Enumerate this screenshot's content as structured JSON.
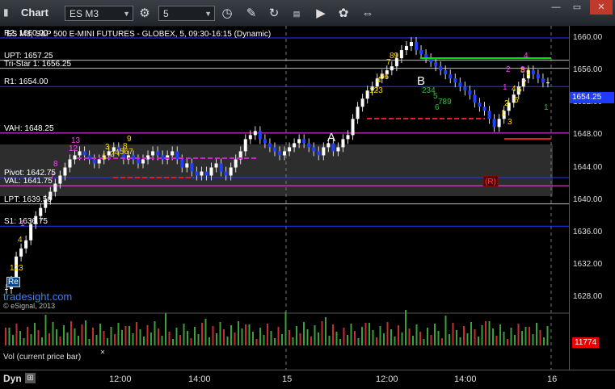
{
  "window": {
    "title": "Chart",
    "symbol": "ES M3",
    "interval": "5",
    "controls": {
      "minimize": "—",
      "restore": "▭",
      "close": "✕"
    }
  },
  "chart": {
    "header": "ES M3, S&P 500 E-MINI FUTURES - GLOBEX, 5, 09:30-16:15 (Dynamic)",
    "watermark_brand": "tradesight.com",
    "copyright": "© eSignal, 2013",
    "current_price": "1654.25",
    "pattern_labels": [
      "A",
      "B"
    ],
    "signal_box": "(R)"
  },
  "levels": [
    {
      "name": "R2",
      "text": "R2: 1660.00",
      "price": 1660.0,
      "color": "#1e3cff"
    },
    {
      "name": "UPT",
      "text": "UPT: 1657.25",
      "price": 1657.25,
      "color": "#bbbbbb"
    },
    {
      "name": "TriStar",
      "text": "Tri-Star 1: 1656.25",
      "price": 1656.25,
      "color": "#bbbbbb"
    },
    {
      "name": "R1",
      "text": "R1: 1654.00",
      "price": 1654.0,
      "color": "#1e3cff"
    },
    {
      "name": "VAH",
      "text": "VAH: 1648.25",
      "price": 1648.25,
      "color": "#ff3fff"
    },
    {
      "name": "Pivot",
      "text": "Pivot: 1642.75",
      "price": 1642.75,
      "color": "#1e3cff"
    },
    {
      "name": "VAL",
      "text": "VAL: 1641.75",
      "price": 1641.75,
      "color": "#ff3fff"
    },
    {
      "name": "LPT",
      "text": "LPT: 1639.50",
      "price": 1639.5,
      "color": "#bbbbbb"
    },
    {
      "name": "S1",
      "text": "S1: 1636.75",
      "price": 1636.75,
      "color": "#1e3cff"
    }
  ],
  "y_axis": {
    "ticks": [
      "1660.00",
      "1656.00",
      "1652.00",
      "1648.00",
      "1644.00",
      "1640.00",
      "1636.00",
      "1632.00",
      "1628.00"
    ],
    "min": 1627,
    "max": 1661.5
  },
  "x_axis": {
    "ticks": [
      "12:00",
      "14:00",
      "15",
      "12:00",
      "14:00",
      "16"
    ]
  },
  "volume": {
    "label": "Vol (current price bar)",
    "value": "11774"
  },
  "footer": {
    "mode": "Dyn"
  }
}
